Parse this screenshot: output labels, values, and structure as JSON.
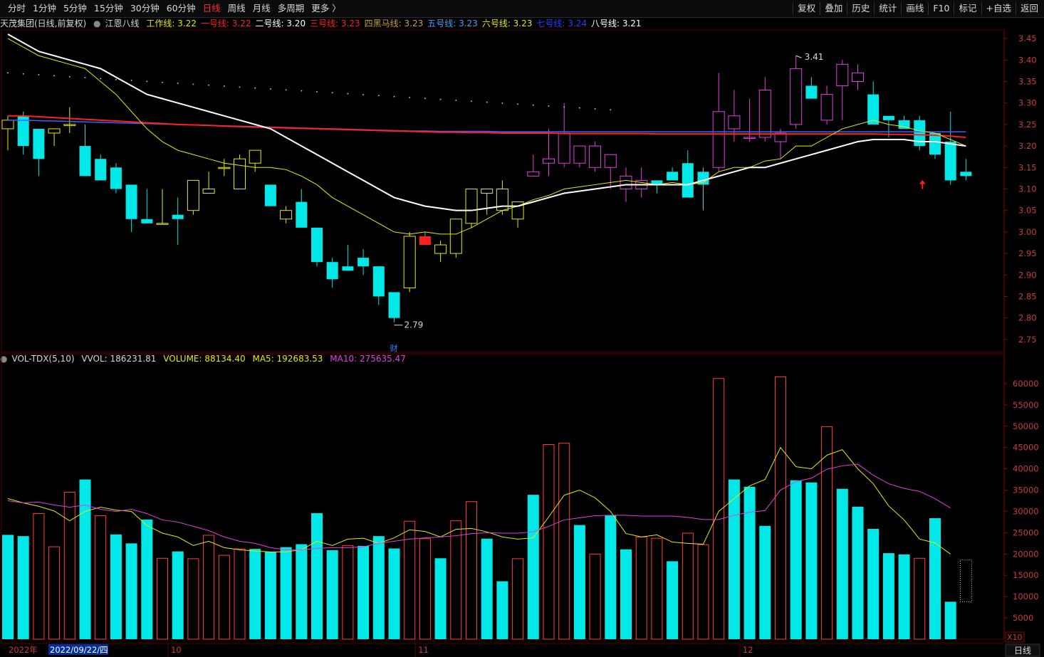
{
  "toolbar": {
    "periods": [
      "分时",
      "1分钟",
      "5分钟",
      "15分钟",
      "30分钟",
      "60分钟",
      "日线",
      "周线",
      "月线",
      "多周期",
      "更多 〉"
    ],
    "active_period": "日线",
    "tools": [
      "复权",
      "叠加",
      "历史",
      "统计",
      "画线",
      "F10",
      "标记",
      "+自选",
      "返回"
    ]
  },
  "main": {
    "title": "天茂集团(日线,前复权)",
    "indicator_name": "江恩八线",
    "lines": [
      {
        "label": "工作线: 3.22",
        "color": "#e8e800"
      },
      {
        "label": "一号线: 3.22",
        "color": "#ff2020"
      },
      {
        "label": "二号线: 3.20",
        "color": "#ffffff"
      },
      {
        "label": "三号线: 3.23",
        "color": "#ff2020"
      },
      {
        "label": "四黑马线: 3.23",
        "color": "#c8a040"
      },
      {
        "label": "五号线: 3.23",
        "color": "#40a0ff"
      },
      {
        "label": "六号线: 3.23",
        "color": "#e8e800"
      },
      {
        "label": "七号线: 3.24",
        "color": "#2040ff"
      },
      {
        "label": "八号线: 3.21",
        "color": "#ffffff"
      }
    ],
    "marker_high": "3.41",
    "marker_low": "2.79",
    "event_marker": "财"
  },
  "volume": {
    "title": "VOL-TDX(5,10)",
    "vvol": "VVOL: 186231.81",
    "volume_label": "VOLUME: 88134.40",
    "ma5_label": "MA5: 192683.53",
    "ma10_label": "MA10: 275635.47",
    "unit": "X10"
  },
  "bottom": {
    "year": "2022年",
    "selected_date": "2022/09/22/四",
    "month_labels": [
      "10",
      "11",
      "12"
    ],
    "period": "日线"
  },
  "colors": {
    "up": "#ff3c3c",
    "down": "#00e8e8",
    "ma_yellow": "#e8e800",
    "ma_white": "#ffffff",
    "axis_text": "#c83c3c",
    "grid": "#5a0000"
  },
  "chart_data": [
    {
      "type": "candlestick",
      "title": "天茂集团(日线,前复权)",
      "ylim": [
        2.72,
        3.47
      ],
      "yticks": [
        2.75,
        2.8,
        2.85,
        2.9,
        2.95,
        3.0,
        3.05,
        3.1,
        3.15,
        3.2,
        3.25,
        3.3,
        3.35,
        3.4,
        3.45
      ],
      "candles": [
        {
          "o": 3.24,
          "h": 3.27,
          "l": 3.19,
          "c": 3.26
        },
        {
          "o": 3.27,
          "h": 3.28,
          "l": 3.18,
          "c": 3.2
        },
        {
          "o": 3.24,
          "h": 3.24,
          "l": 3.13,
          "c": 3.17
        },
        {
          "o": 3.23,
          "h": 3.24,
          "l": 3.2,
          "c": 3.24
        },
        {
          "o": 3.25,
          "h": 3.29,
          "l": 3.23,
          "c": 3.25
        },
        {
          "o": 3.2,
          "h": 3.25,
          "l": 3.13,
          "c": 3.13
        },
        {
          "o": 3.17,
          "h": 3.18,
          "l": 3.12,
          "c": 3.12
        },
        {
          "o": 3.15,
          "h": 3.16,
          "l": 3.09,
          "c": 3.1
        },
        {
          "o": 3.11,
          "h": 3.11,
          "l": 3.0,
          "c": 3.03
        },
        {
          "o": 3.03,
          "h": 3.1,
          "l": 3.02,
          "c": 3.02
        },
        {
          "o": 3.02,
          "h": 3.1,
          "l": 3.02,
          "c": 3.02
        },
        {
          "o": 3.04,
          "h": 3.08,
          "l": 2.97,
          "c": 3.03
        },
        {
          "o": 3.05,
          "h": 3.12,
          "l": 3.04,
          "c": 3.12
        },
        {
          "o": 3.09,
          "h": 3.14,
          "l": 3.09,
          "c": 3.1
        },
        {
          "o": 3.15,
          "h": 3.17,
          "l": 3.13,
          "c": 3.15
        },
        {
          "o": 3.1,
          "h": 3.18,
          "l": 3.1,
          "c": 3.17
        },
        {
          "o": 3.16,
          "h": 3.19,
          "l": 3.14,
          "c": 3.19
        },
        {
          "o": 3.11,
          "h": 3.11,
          "l": 3.07,
          "c": 3.06
        },
        {
          "o": 3.03,
          "h": 3.06,
          "l": 3.02,
          "c": 3.05
        },
        {
          "o": 3.07,
          "h": 3.1,
          "l": 3.01,
          "c": 3.01
        },
        {
          "o": 3.01,
          "h": 3.01,
          "l": 2.92,
          "c": 2.93
        },
        {
          "o": 2.93,
          "h": 2.94,
          "l": 2.87,
          "c": 2.89
        },
        {
          "o": 2.92,
          "h": 2.97,
          "l": 2.91,
          "c": 2.91
        },
        {
          "o": 2.94,
          "h": 2.96,
          "l": 2.9,
          "c": 2.92
        },
        {
          "o": 2.92,
          "h": 2.92,
          "l": 2.83,
          "c": 2.85
        },
        {
          "o": 2.86,
          "h": 2.86,
          "l": 2.79,
          "c": 2.8
        },
        {
          "o": 2.87,
          "h": 3.0,
          "l": 2.86,
          "c": 2.99
        },
        {
          "o": 2.99,
          "h": 3.0,
          "l": 2.97,
          "c": 2.97
        },
        {
          "o": 2.95,
          "h": 2.98,
          "l": 2.93,
          "c": 2.97
        },
        {
          "o": 2.95,
          "h": 3.03,
          "l": 2.94,
          "c": 3.03
        },
        {
          "o": 3.02,
          "h": 3.1,
          "l": 3.01,
          "c": 3.1
        },
        {
          "o": 3.09,
          "h": 3.1,
          "l": 3.04,
          "c": 3.1
        },
        {
          "o": 3.05,
          "h": 3.12,
          "l": 3.04,
          "c": 3.1
        },
        {
          "o": 3.03,
          "h": 3.07,
          "l": 3.01,
          "c": 3.07
        },
        {
          "o": 3.13,
          "h": 3.18,
          "l": 3.13,
          "c": 3.14
        },
        {
          "o": 3.16,
          "h": 3.24,
          "l": 3.13,
          "c": 3.17
        },
        {
          "o": 3.16,
          "h": 3.3,
          "l": 3.15,
          "c": 3.23
        },
        {
          "o": 3.16,
          "h": 3.2,
          "l": 3.15,
          "c": 3.2
        },
        {
          "o": 3.15,
          "h": 3.21,
          "l": 3.14,
          "c": 3.2
        },
        {
          "o": 3.15,
          "h": 3.18,
          "l": 3.1,
          "c": 3.18
        },
        {
          "o": 3.1,
          "h": 3.15,
          "l": 3.07,
          "c": 3.13
        },
        {
          "o": 3.1,
          "h": 3.15,
          "l": 3.08,
          "c": 3.12
        },
        {
          "o": 3.12,
          "h": 3.12,
          "l": 3.09,
          "c": 3.11
        },
        {
          "o": 3.14,
          "h": 3.15,
          "l": 3.12,
          "c": 3.12
        },
        {
          "o": 3.16,
          "h": 3.19,
          "l": 3.08,
          "c": 3.08
        },
        {
          "o": 3.14,
          "h": 3.15,
          "l": 3.05,
          "c": 3.11
        },
        {
          "o": 3.15,
          "h": 3.37,
          "l": 3.14,
          "c": 3.28
        },
        {
          "o": 3.24,
          "h": 3.33,
          "l": 3.21,
          "c": 3.27
        },
        {
          "o": 3.22,
          "h": 3.31,
          "l": 3.21,
          "c": 3.22
        },
        {
          "o": 3.22,
          "h": 3.36,
          "l": 3.21,
          "c": 3.33
        },
        {
          "o": 3.21,
          "h": 3.24,
          "l": 3.17,
          "c": 3.23
        },
        {
          "o": 3.25,
          "h": 3.41,
          "l": 3.24,
          "c": 3.38
        },
        {
          "o": 3.34,
          "h": 3.36,
          "l": 3.31,
          "c": 3.31
        },
        {
          "o": 3.26,
          "h": 3.34,
          "l": 3.25,
          "c": 3.32
        },
        {
          "o": 3.34,
          "h": 3.4,
          "l": 3.26,
          "c": 3.39
        },
        {
          "o": 3.35,
          "h": 3.39,
          "l": 3.33,
          "c": 3.37
        },
        {
          "o": 3.32,
          "h": 3.35,
          "l": 3.25,
          "c": 3.25
        },
        {
          "o": 3.27,
          "h": 3.27,
          "l": 3.22,
          "c": 3.26
        },
        {
          "o": 3.26,
          "h": 3.27,
          "l": 3.24,
          "c": 3.24
        },
        {
          "o": 3.26,
          "h": 3.27,
          "l": 3.19,
          "c": 3.2
        },
        {
          "o": 3.23,
          "h": 3.23,
          "l": 3.17,
          "c": 3.18
        },
        {
          "o": 3.21,
          "h": 3.28,
          "l": 3.11,
          "c": 3.12
        },
        {
          "o": 3.14,
          "h": 3.17,
          "l": 3.12,
          "c": 3.13
        }
      ],
      "ma_yellow": [
        3.45,
        3.43,
        3.41,
        3.4,
        3.39,
        3.38,
        3.35,
        3.32,
        3.28,
        3.24,
        3.21,
        3.19,
        3.18,
        3.17,
        3.16,
        3.155,
        3.15,
        3.15,
        3.145,
        3.13,
        3.11,
        3.08,
        3.06,
        3.04,
        3.02,
        3.0,
        2.995,
        3.0,
        2.995,
        2.995,
        3.01,
        3.03,
        3.05,
        3.06,
        3.075,
        3.085,
        3.1,
        3.105,
        3.11,
        3.115,
        3.12,
        3.115,
        3.11,
        3.115,
        3.11,
        3.115,
        3.14,
        3.15,
        3.15,
        3.165,
        3.17,
        3.2,
        3.2,
        3.22,
        3.24,
        3.25,
        3.26,
        3.25,
        3.245,
        3.235,
        3.23,
        3.215,
        3.2
      ],
      "ma_white": [
        3.46,
        3.44,
        3.42,
        3.41,
        3.4,
        3.39,
        3.38,
        3.36,
        3.34,
        3.32,
        3.31,
        3.3,
        3.29,
        3.28,
        3.27,
        3.26,
        3.25,
        3.24,
        3.22,
        3.2,
        3.18,
        3.16,
        3.14,
        3.12,
        3.1,
        3.08,
        3.07,
        3.06,
        3.055,
        3.05,
        3.05,
        3.055,
        3.06,
        3.06,
        3.07,
        3.08,
        3.09,
        3.095,
        3.1,
        3.105,
        3.11,
        3.11,
        3.11,
        3.11,
        3.11,
        3.12,
        3.13,
        3.14,
        3.15,
        3.15,
        3.16,
        3.17,
        3.18,
        3.19,
        3.2,
        3.21,
        3.215,
        3.215,
        3.215,
        3.21,
        3.21,
        3.205,
        3.2
      ],
      "ma_red": [
        3.27,
        3.27,
        3.268,
        3.266,
        3.264,
        3.262,
        3.26,
        3.258,
        3.256,
        3.254,
        3.252,
        3.25,
        3.249,
        3.248,
        3.246,
        3.245,
        3.244,
        3.243,
        3.242,
        3.241,
        3.24,
        3.239,
        3.238,
        3.237,
        3.236,
        3.235,
        3.234,
        3.233,
        3.232,
        3.232,
        3.231,
        3.231,
        3.23,
        3.23,
        3.23,
        3.23,
        3.229,
        3.229,
        3.229,
        3.229,
        3.229,
        3.229,
        3.228,
        3.228,
        3.228,
        3.228,
        3.228,
        3.228,
        3.228,
        3.228,
        3.228,
        3.228,
        3.228,
        3.228,
        3.228,
        3.228,
        3.228,
        3.227,
        3.227,
        3.226,
        3.225,
        3.223,
        3.22
      ],
      "ma_blue": [
        3.26,
        3.26,
        3.259,
        3.258,
        3.257,
        3.256,
        3.255,
        3.254,
        3.253,
        3.252,
        3.251,
        3.25,
        3.249,
        3.248,
        3.247,
        3.246,
        3.245,
        3.244,
        3.243,
        3.242,
        3.241,
        3.24,
        3.239,
        3.238,
        3.237,
        3.236,
        3.235,
        3.235,
        3.234,
        3.234,
        3.234,
        3.234,
        3.233,
        3.233,
        3.233,
        3.233,
        3.233,
        3.233,
        3.233,
        3.233,
        3.233,
        3.233,
        3.233,
        3.233,
        3.233,
        3.233,
        3.233,
        3.233,
        3.233,
        3.233,
        3.233,
        3.233,
        3.233,
        3.233,
        3.233,
        3.233,
        3.233,
        3.233,
        3.233,
        3.233,
        3.233,
        3.233,
        3.233
      ]
    },
    {
      "type": "bar",
      "title": "VOL-TDX(5,10)",
      "ylim": [
        0,
        64000
      ],
      "yticks": [
        5000,
        10000,
        15000,
        20000,
        25000,
        30000,
        35000,
        40000,
        45000,
        50000,
        55000,
        60000
      ],
      "values": [
        24500,
        24200,
        29500,
        21700,
        34500,
        37500,
        29000,
        24600,
        22500,
        28100,
        19000,
        20600,
        18900,
        24400,
        19700,
        21200,
        21200,
        20500,
        21600,
        22300,
        29600,
        20900,
        22000,
        21900,
        24200,
        21300,
        27700,
        23600,
        19000,
        27800,
        32300,
        23600,
        13600,
        18900,
        33900,
        45700,
        46000,
        26800,
        20000,
        29100,
        21100,
        24000,
        23700,
        18300,
        24900,
        22200,
        61200,
        37500,
        35800,
        26600,
        61600,
        37300,
        36800,
        49900,
        35300,
        31100,
        25900,
        20200,
        19900,
        19000,
        28400,
        8800
      ],
      "up": [
        false,
        false,
        true,
        true,
        true,
        false,
        true,
        false,
        false,
        false,
        true,
        false,
        true,
        true,
        true,
        true,
        false,
        false,
        false,
        false,
        false,
        false,
        true,
        false,
        false,
        false,
        true,
        true,
        false,
        true,
        true,
        false,
        false,
        true,
        false,
        true,
        true,
        false,
        true,
        false,
        false,
        true,
        true,
        false,
        true,
        true,
        true,
        false,
        false,
        false,
        true,
        false,
        false,
        true,
        false,
        false,
        false,
        false,
        false,
        true,
        false,
        false
      ],
      "ma5": [
        33000,
        32000,
        31200,
        30100,
        27800,
        30000,
        31000,
        30300,
        30000,
        26700,
        24900,
        24000,
        22000,
        23000,
        21500,
        21000,
        20700,
        20500,
        20500,
        21000,
        23000,
        22000,
        23500,
        23700,
        22500,
        23800,
        25700,
        25300,
        24000,
        25800,
        26000,
        25200,
        24000,
        23500,
        23800,
        28700,
        33800,
        35000,
        33200,
        30000,
        24800,
        24000,
        24500,
        22800,
        22500,
        22300,
        30000,
        33000,
        36000,
        37500,
        45000,
        40500,
        40000,
        43200,
        44500,
        40000,
        36500,
        31300,
        28000,
        23500,
        22600,
        20000
      ],
      "ma10": [
        32500,
        32000,
        32200,
        31500,
        31000,
        31500,
        30500,
        30000,
        30500,
        29500,
        28000,
        27500,
        26500,
        25500,
        24000,
        23000,
        22500,
        21500,
        21000,
        21000,
        21300,
        21500,
        21500,
        21700,
        22500,
        23000,
        23500,
        23800,
        24000,
        24300,
        24800,
        25000,
        24900,
        24900,
        25200,
        26500,
        28000,
        28500,
        29000,
        29100,
        29100,
        28900,
        28900,
        28900,
        28600,
        28100,
        28100,
        29100,
        29800,
        30200,
        35000,
        37000,
        37800,
        39900,
        40700,
        41100,
        38500,
        36500,
        35400,
        34700,
        33000,
        30800
      ]
    }
  ]
}
